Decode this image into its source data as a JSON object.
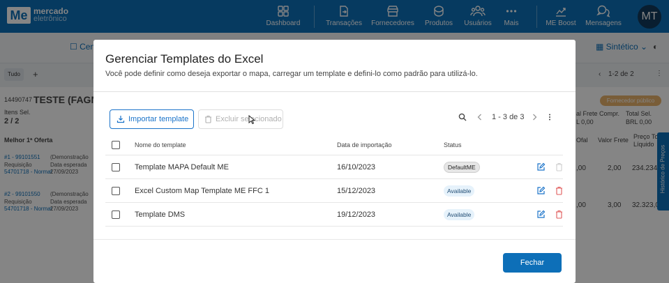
{
  "topbar": {
    "logo_mark": "Me",
    "logo_line1": "mercado",
    "logo_line2": "eletrônico",
    "nav": [
      {
        "label": "Dashboard",
        "icon": "dashboard-icon"
      },
      {
        "label": "Transações",
        "icon": "transactions-icon"
      },
      {
        "label": "Fornecedores",
        "icon": "suppliers-icon"
      },
      {
        "label": "Produtos",
        "icon": "products-icon"
      },
      {
        "label": "Usuários",
        "icon": "users-icon"
      },
      {
        "label": "Mais",
        "icon": "more-dots-icon"
      },
      {
        "label": "ME Boost",
        "icon": "boost-chart-icon"
      },
      {
        "label": "Mensagens",
        "icon": "messages-icon"
      }
    ],
    "avatar": "MT",
    "color": "#0d6fb8"
  },
  "background": {
    "sub_link_left": "Cen",
    "sub_link_right": "Sintético",
    "tab_chip": "Tudo",
    "pagination": "1-2 de 2",
    "request_id": "14490747",
    "request_title": "TESTE (FAGNE",
    "itens_label": "Itens Sel.",
    "itens_value": "2 / 2",
    "best_offer": "Melhor 1ª Oferta",
    "rows": [
      {
        "num": "#1 - 99101551",
        "demo": "(Demonstração",
        "req_label": "Requisição",
        "date_label": "Data esperada",
        "req": "54701718 - Normal",
        "date": "27/09/2023"
      },
      {
        "num": "#2 - 99101550",
        "demo": "(Demonstração",
        "req_label": "Requisição",
        "date_label": "Data esperada",
        "req": "54701718 - Normal",
        "date": "27/09/2023"
      }
    ],
    "public_badge": "Fornecedor público",
    "frete_compr": "al Frete Compr.",
    "frete_compr_val": "L 0,00",
    "total_sel": "Total Sel.",
    "total_sel_val": "BRL 0,00",
    "col_ofal": "Ofal",
    "col_valor_frete": "Valor Frete",
    "col_preco": "Preço To",
    "col_liquido": "Líquido",
    "vals": [
      {
        "a": ",00",
        "b": "2,00",
        "c": "234.234,"
      },
      {
        "a": ",00",
        "b": "3,00",
        "c": "32.323,0"
      }
    ],
    "side_tab": "Histórico de Preços"
  },
  "modal": {
    "title": "Gerenciar Templates do Excel",
    "subtitle": "Você pode definir como deseja exportar o mapa, carregar um template e defini-lo como padrão para utilizá-lo.",
    "import_button": "Importar template",
    "delete_button": "Excluir selecionado",
    "pagination": "1 - 3 de 3",
    "columns": {
      "name": "Nome do template",
      "date": "Data de importação",
      "status": "Status"
    },
    "rows": [
      {
        "name": "Template MAPA Default ME",
        "date": "16/10/2023",
        "status": "DefaultME",
        "deletable": false
      },
      {
        "name": "Excel Custom Map Template ME FFC 1",
        "date": "15/12/2023",
        "status": "Available",
        "deletable": true
      },
      {
        "name": "Template DMS",
        "date": "19/12/2023",
        "status": "Available",
        "deletable": true
      }
    ],
    "close_button": "Fechar",
    "accent": "#1a73c9",
    "danger": "#e05a5a"
  }
}
